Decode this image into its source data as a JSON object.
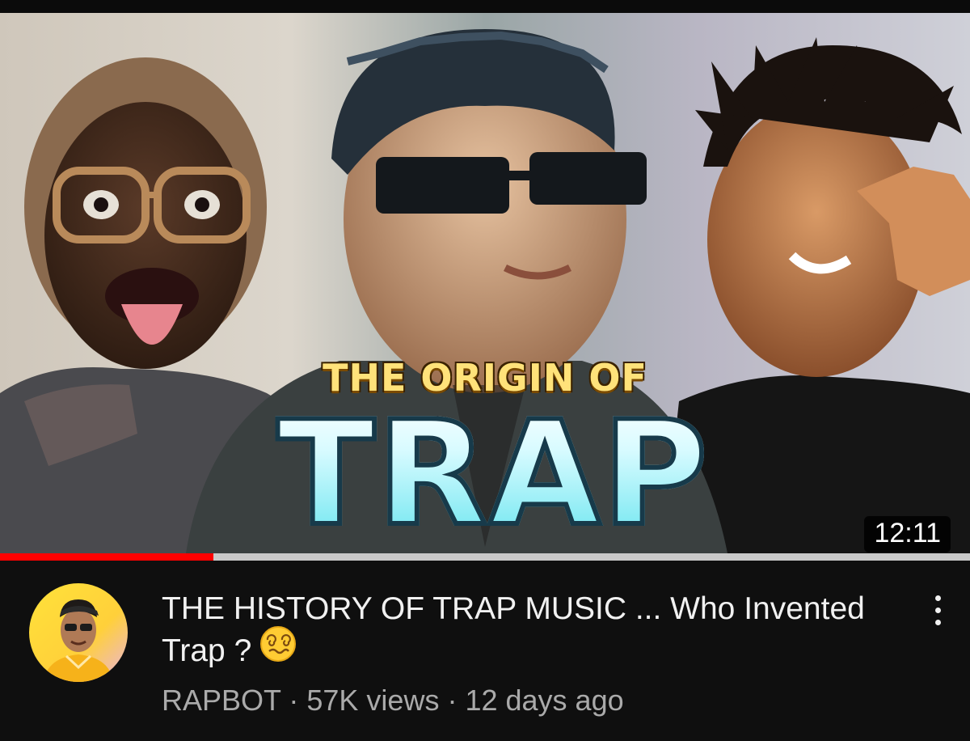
{
  "thumbnail": {
    "headline_small": "THE ORIGIN OF",
    "headline_big": "TRAP",
    "duration": "12:11"
  },
  "progress": {
    "watched_fraction": 0.22,
    "fill_color": "#ff0000",
    "track_color": "#c9c9c9"
  },
  "video": {
    "title": "THE HISTORY OF TRAP MUSIC ... Who Invented Trap ?",
    "title_emoji": "dizzy-face-emoji",
    "channel": "RAPBOT",
    "separator": " · ",
    "views": "57K views",
    "age": "12 days ago"
  },
  "icons": {
    "more": "vertical-ellipsis-icon"
  },
  "colors": {
    "background": "#0f0f0f",
    "title_text": "#f1f1f1",
    "meta_text": "#aaaaaa",
    "avatar_bg": "#ffd83a"
  }
}
